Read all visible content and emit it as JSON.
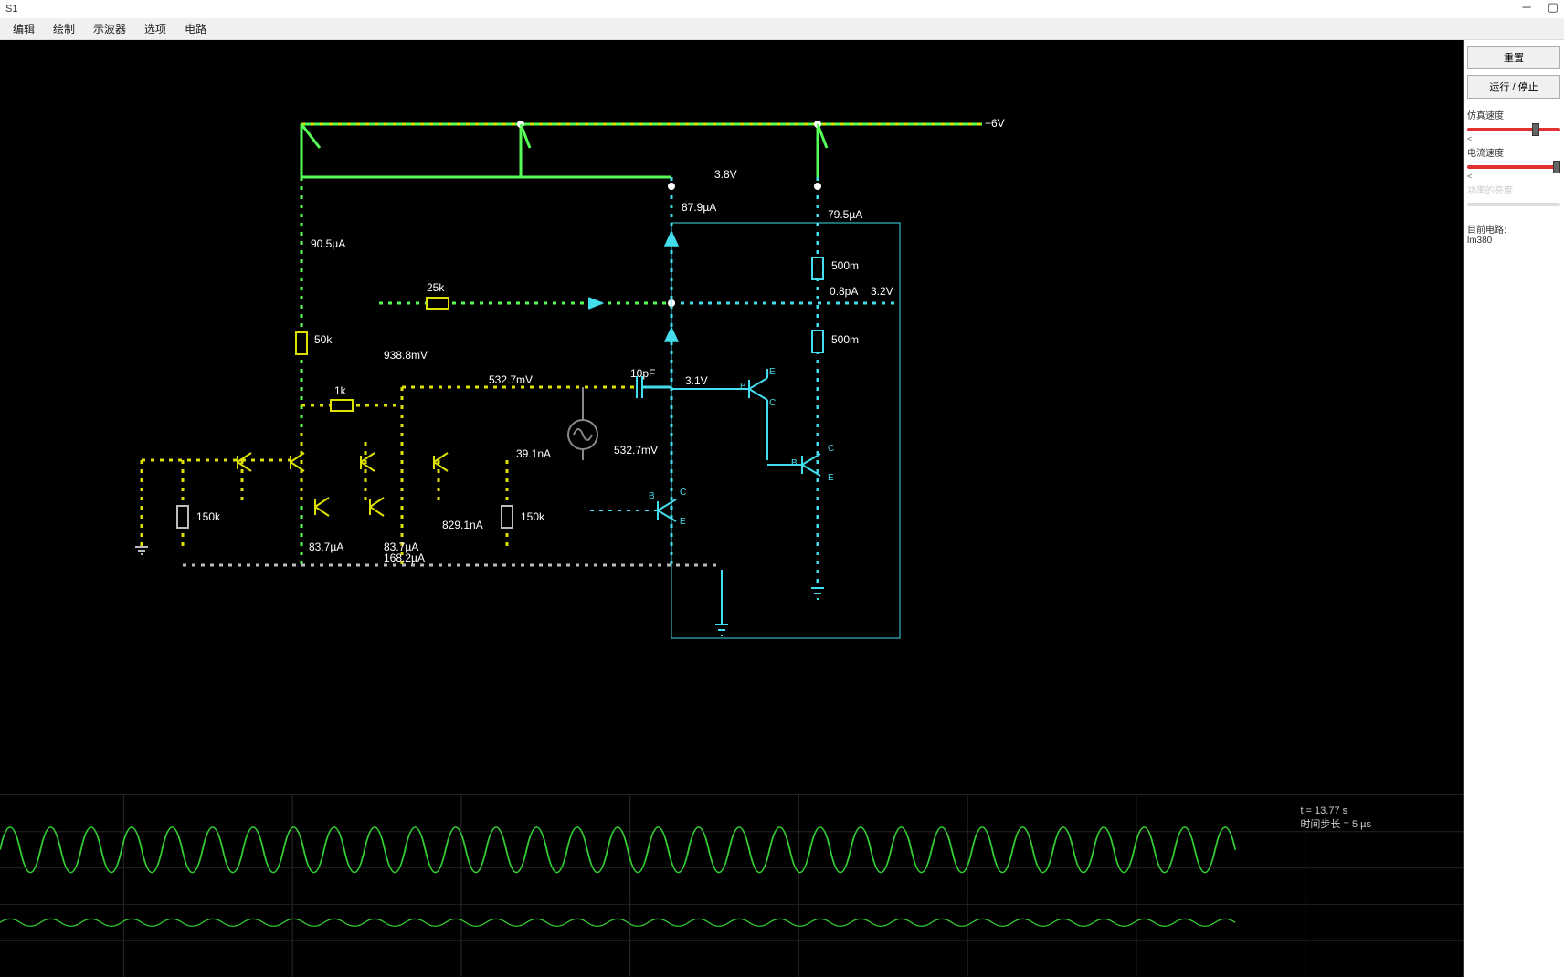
{
  "title": "S1",
  "menu": {
    "edit": "编辑",
    "draw": "绘制",
    "scope": "示波器",
    "options": "选项",
    "circuit": "电路"
  },
  "panel": {
    "reset": "重置",
    "runstop": "运行 / 停止",
    "simspeed": "仿真速度",
    "curspeed": "电流速度",
    "powerbright": "功率的亮度",
    "currentcircuit_lbl": "目前电路:",
    "currentcircuit": "lm380"
  },
  "scope": {
    "time": "t = 13.77 s",
    "step": "时间步长 = 5 µs"
  },
  "labels": {
    "v6": "+6V",
    "v38": "3.8V",
    "i879": "87.9µA",
    "i795": "79.5µA",
    "i905": "90.5µA",
    "r500a": "500m",
    "r500b": "500m",
    "r25k": "25k",
    "r50k": "50k",
    "v9388": "938.8mV",
    "v5327": "532.7mV",
    "v5327b": "532.7mV",
    "c10": "10pF",
    "v31": "3.1V",
    "r1k": "1k",
    "r150ka": "150k",
    "r150kb": "150k",
    "i391": "39.1nA",
    "i8291": "829.1nA",
    "i837a": "83.7µA",
    "i837b": "83.7µA",
    "i1682": "168.2µA",
    "p08": "0.8pA",
    "v32": "3.2V"
  },
  "tpins": {
    "b1": "B",
    "c1": "C",
    "e1": "E",
    "b2": "B",
    "c2": "C",
    "e2": "E",
    "b3": "B",
    "c3": "C",
    "e3": "E"
  }
}
